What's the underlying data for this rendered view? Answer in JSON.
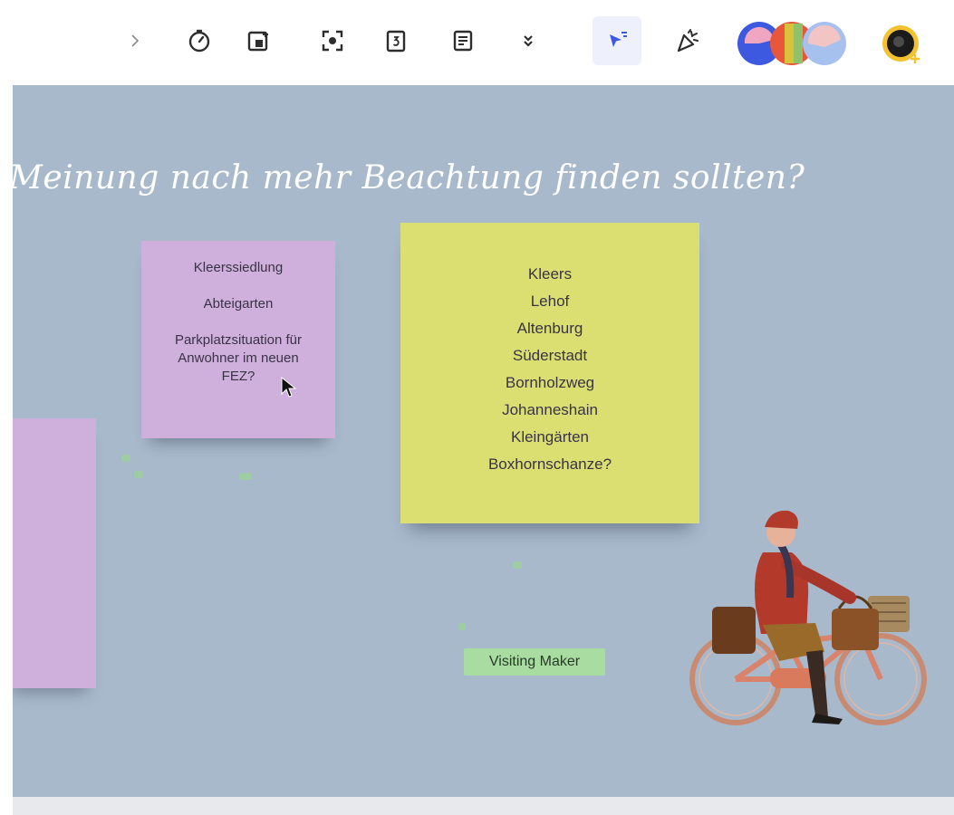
{
  "toolbar": {
    "buttons": [
      {
        "name": "expand-chevron",
        "icon": "chevron-right-icon"
      },
      {
        "name": "timer",
        "icon": "timer-icon"
      },
      {
        "name": "card",
        "icon": "card-icon"
      },
      {
        "name": "focus",
        "icon": "focus-icon"
      },
      {
        "name": "calendar",
        "icon": "calendar-icon"
      },
      {
        "name": "notes",
        "icon": "notes-icon"
      },
      {
        "name": "more",
        "icon": "double-chevron-down-icon"
      },
      {
        "name": "cursor-tool",
        "icon": "cursor-select-icon",
        "active": true
      },
      {
        "name": "celebrate",
        "icon": "party-popper-icon"
      }
    ],
    "colors": {
      "accent": "#3d59e0",
      "icon": "#2d2d2d"
    }
  },
  "board": {
    "background": "#a8b9cb",
    "headline": "Meinung nach mehr Beachtung finden sollten?",
    "sticky_pink": {
      "color": "#cfafdb",
      "paragraphs": [
        "Kleerssiedlung",
        "Abteigarten",
        "Parkplatzsituation für Anwohner im neuen FEZ?"
      ]
    },
    "sticky_yellow": {
      "color": "#dbdf72",
      "lines": [
        "Kleers",
        "Lehof",
        "Altenburg",
        "Süderstadt",
        "Bornholzweg",
        "Johanneshain",
        "Kleingärten",
        "Boxhornschanze?"
      ]
    },
    "sticky_pink_left": {
      "color": "#cfafdb"
    },
    "tag": {
      "label": "Visiting Maker",
      "color": "#a8dca0"
    }
  }
}
